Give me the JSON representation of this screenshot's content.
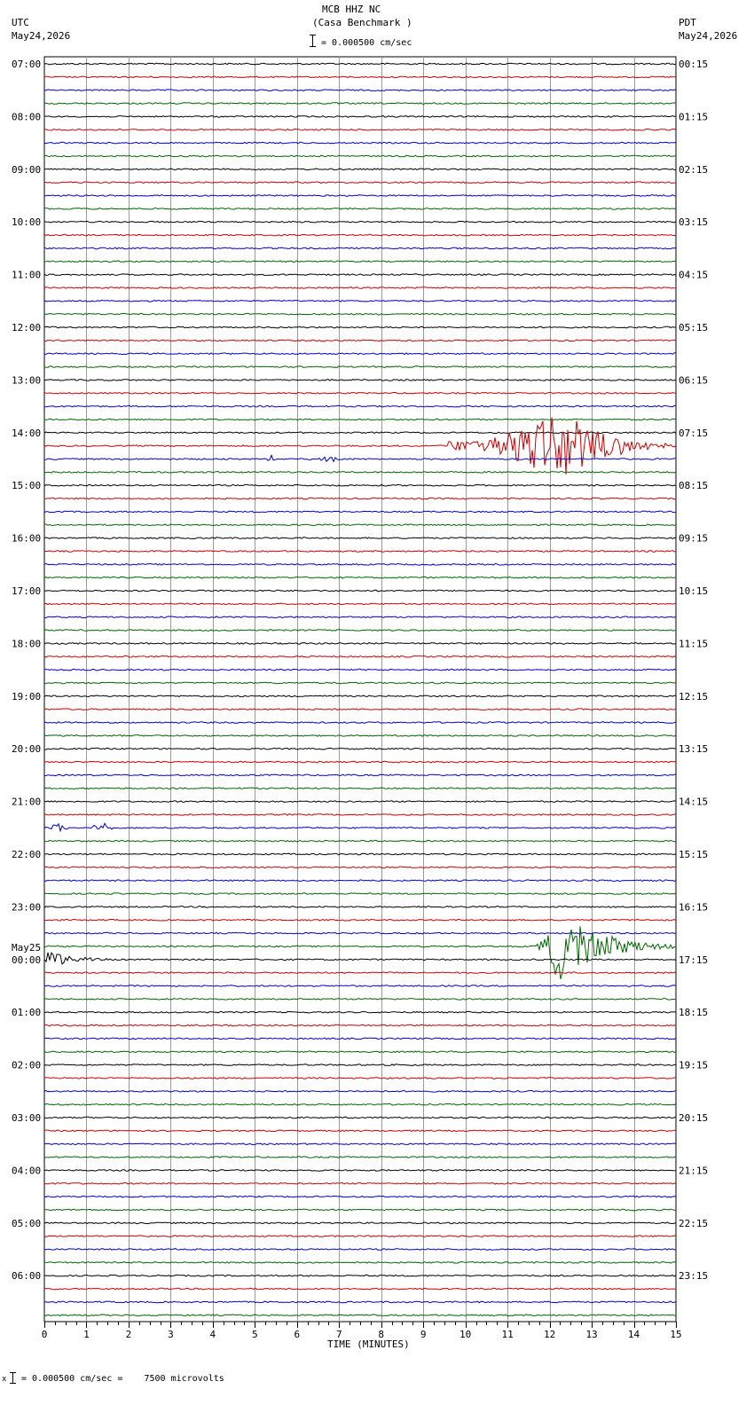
{
  "header": {
    "station": "MCB HHZ NC",
    "site": "(Casa Benchmark )",
    "scale_text": "= 0.000500 cm/sec",
    "left_tz": "UTC",
    "left_date": "May24,2026",
    "right_tz": "PDT",
    "right_date": "May24,2026"
  },
  "footer": {
    "scale_text": "= 0.000500 cm/sec =    7500 microvolts",
    "corner_mark": "x"
  },
  "chart_data": {
    "type": "line",
    "title": "MCB HHZ NC (Casa Benchmark )",
    "xlabel": "TIME (MINUTES)",
    "xlim": [
      0,
      15
    ],
    "x_ticks": [
      "0",
      "1",
      "2",
      "3",
      "4",
      "5",
      "6",
      "7",
      "8",
      "9",
      "10",
      "11",
      "12",
      "13",
      "14",
      "15"
    ],
    "trace_colors": [
      "#000000",
      "#cc0000",
      "#0000cc",
      "#006600"
    ],
    "trace_count": 96,
    "traces_per_hour": 4,
    "minutes_per_trace": 15,
    "left_hour_labels": [
      "07:00",
      "08:00",
      "09:00",
      "10:00",
      "11:00",
      "12:00",
      "13:00",
      "14:00",
      "15:00",
      "16:00",
      "17:00",
      "18:00",
      "19:00",
      "20:00",
      "21:00",
      "22:00",
      "23:00",
      "00:00",
      "01:00",
      "02:00",
      "03:00",
      "04:00",
      "05:00",
      "06:00"
    ],
    "right_hour_labels": [
      "00:15",
      "01:15",
      "02:15",
      "03:15",
      "04:15",
      "05:15",
      "06:15",
      "07:15",
      "08:15",
      "09:15",
      "10:15",
      "11:15",
      "12:15",
      "13:15",
      "14:15",
      "15:15",
      "16:15",
      "17:15",
      "18:15",
      "19:15",
      "20:15",
      "21:15",
      "22:15",
      "23:15"
    ],
    "date_change_label": {
      "hour_index": 17,
      "text": "May25"
    },
    "events": [
      {
        "trace": 29,
        "start_min": 9.6,
        "end_min": 15,
        "peak_min": 12.3,
        "amplitude": "large"
      },
      {
        "trace": 30,
        "start_min": 5.2,
        "end_min": 5.6,
        "peak_min": 5.4,
        "amplitude": "small"
      },
      {
        "trace": 30,
        "start_min": 6.3,
        "end_min": 7.3,
        "peak_min": 6.9,
        "amplitude": "small"
      },
      {
        "trace": 58,
        "start_min": 0.1,
        "end_min": 0.6,
        "peak_min": 0.35,
        "amplitude": "medium"
      },
      {
        "trace": 58,
        "start_min": 1.1,
        "end_min": 1.7,
        "peak_min": 1.4,
        "amplitude": "medium"
      },
      {
        "trace": 67,
        "start_min": 11.7,
        "end_min": 15,
        "peak_min": 12.2,
        "amplitude": "large"
      },
      {
        "trace": 68,
        "start_min": 0,
        "end_min": 1.5,
        "peak_min": 0.1,
        "amplitude": "medium"
      }
    ]
  }
}
